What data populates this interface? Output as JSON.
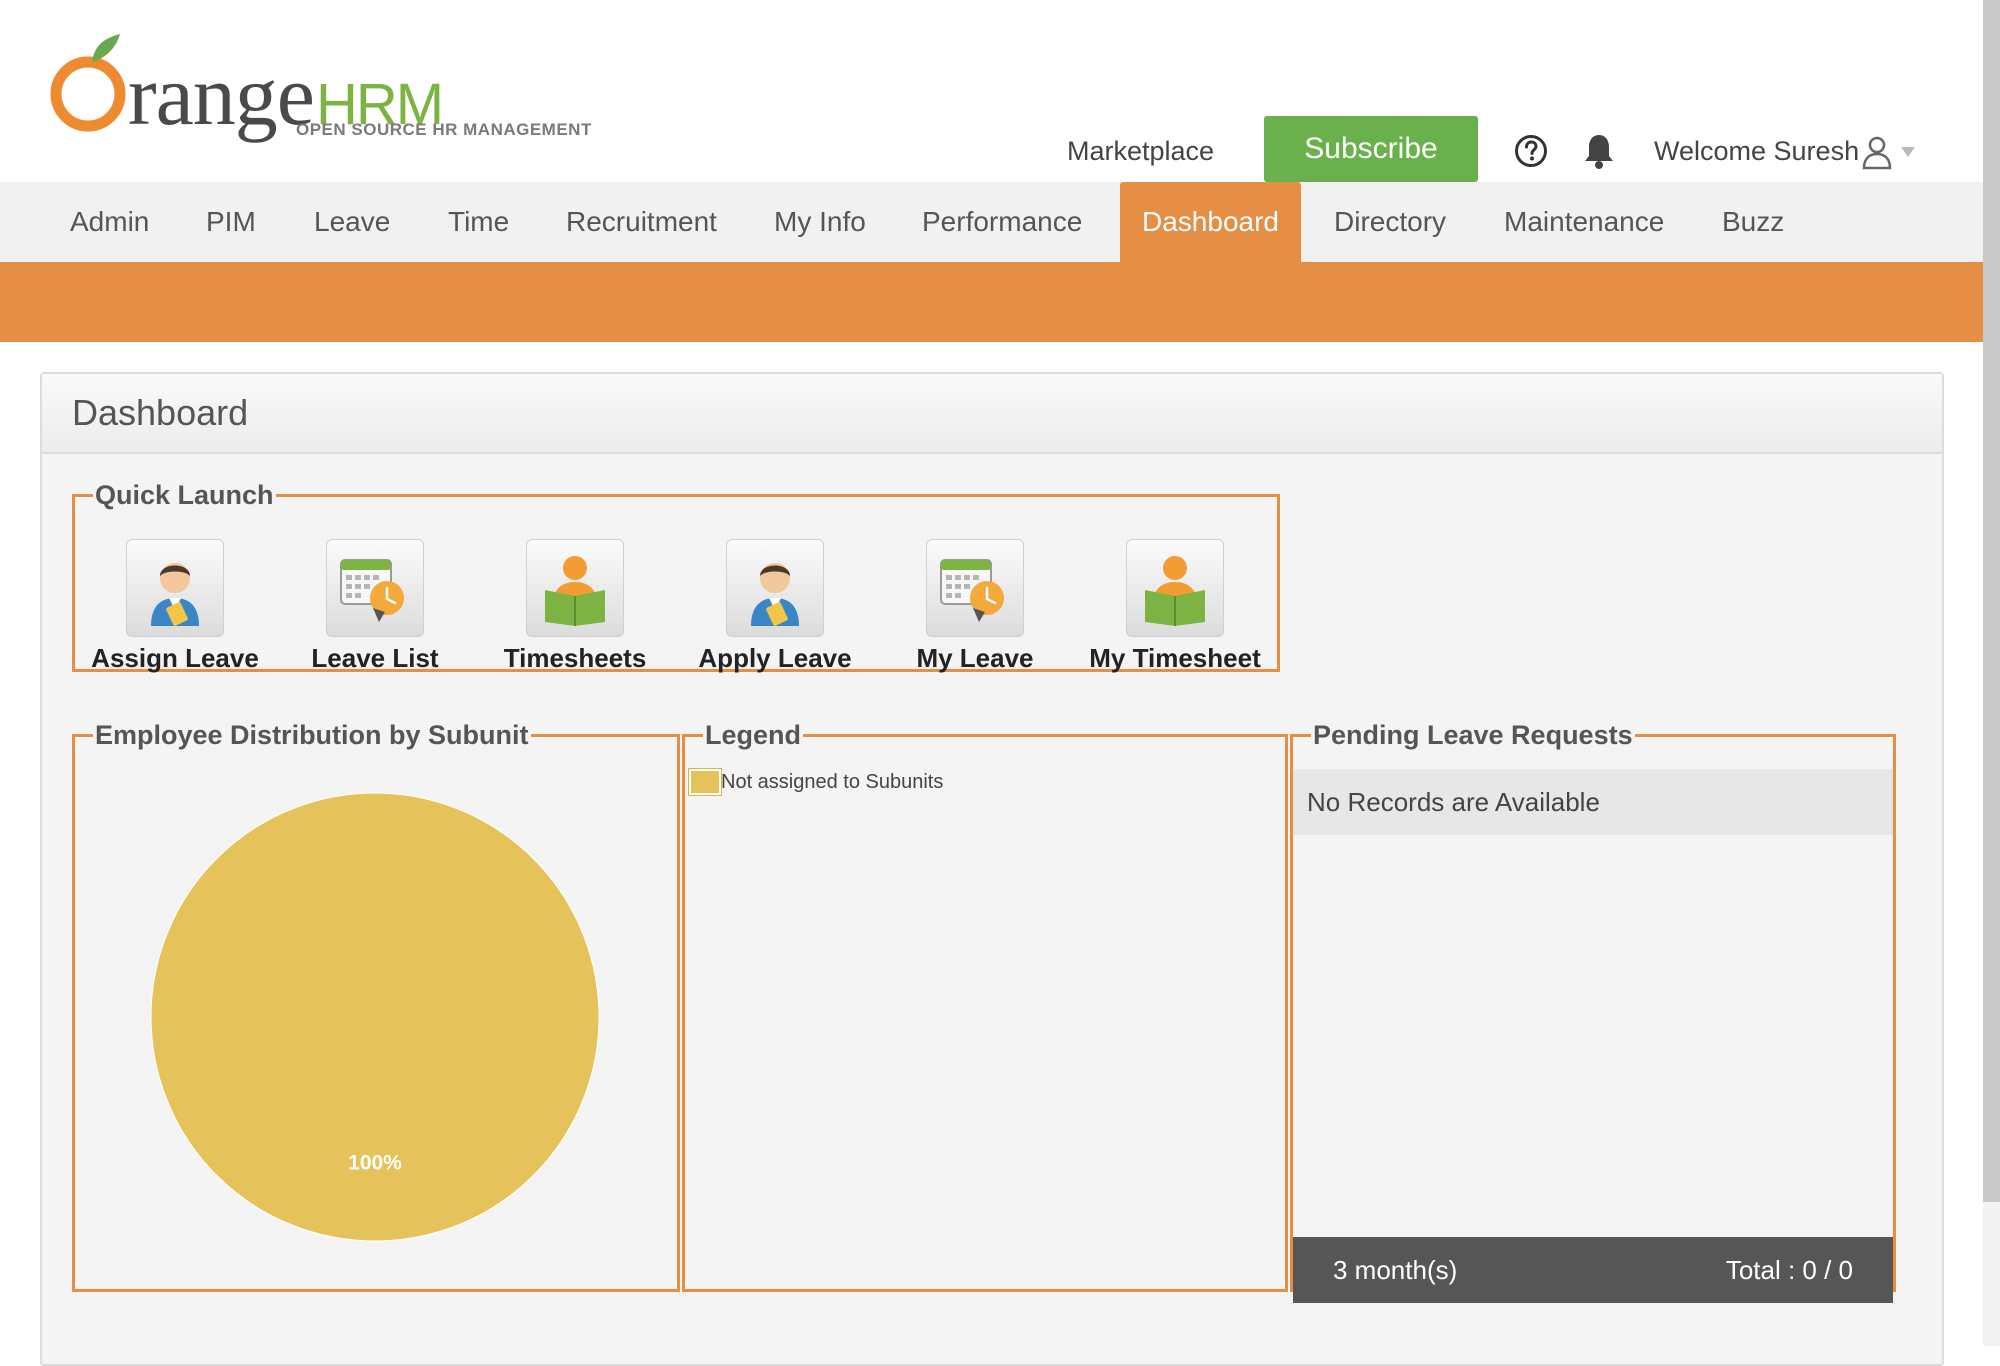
{
  "logo": {
    "word_rest": "range",
    "word_suffix": "HRM",
    "tagline": "OPEN SOURCE HR MANAGEMENT"
  },
  "header": {
    "marketplace": "Marketplace",
    "subscribe": "Subscribe",
    "welcome": "Welcome Suresh",
    "icons": [
      "help-icon",
      "bell-icon",
      "user-icon",
      "caret-down-icon"
    ]
  },
  "nav": {
    "items": [
      "Admin",
      "PIM",
      "Leave",
      "Time",
      "Recruitment",
      "My Info",
      "Performance",
      "Dashboard",
      "Directory",
      "Maintenance",
      "Buzz"
    ],
    "active": "Dashboard"
  },
  "page": {
    "title": "Dashboard"
  },
  "quick_launch": {
    "title": "Quick Launch",
    "items": [
      {
        "label": "Assign Leave",
        "icon": "person-assign-icon"
      },
      {
        "label": "Leave List",
        "icon": "calendar-clock-icon"
      },
      {
        "label": "Timesheets",
        "icon": "person-timesheet-icon"
      },
      {
        "label": "Apply Leave",
        "icon": "person-assign-icon"
      },
      {
        "label": "My Leave",
        "icon": "calendar-clock-icon"
      },
      {
        "label": "My Timesheet",
        "icon": "person-timesheet-icon"
      }
    ]
  },
  "employee_distribution": {
    "title": "Employee Distribution by Subunit"
  },
  "legend": {
    "title": "Legend"
  },
  "pending_leave": {
    "title": "Pending Leave Requests",
    "empty": "No Records are Available",
    "period": "3 month(s)",
    "total": "Total : 0 / 0"
  },
  "colors": {
    "accent": "#e58f46",
    "subscribe": "#6ab04c",
    "pie": "#e5c35a",
    "footer": "#565656"
  },
  "chart_data": {
    "type": "pie",
    "title": "Employee Distribution by Subunit",
    "categories": [
      "Not assigned to Subunits"
    ],
    "values": [
      100
    ],
    "labels": [
      "100%"
    ],
    "legend_placement": "right"
  }
}
